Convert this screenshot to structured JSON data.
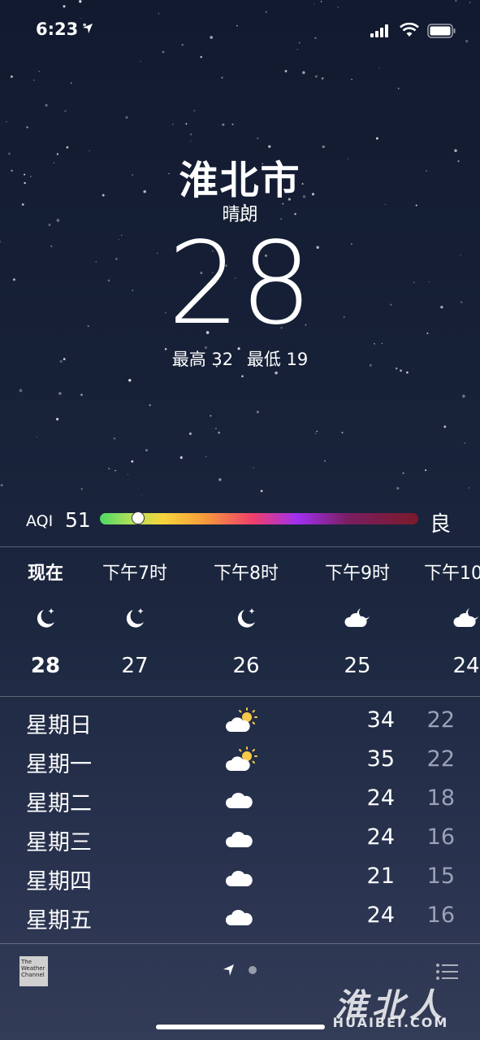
{
  "status_bar": {
    "time": "6:23"
  },
  "current": {
    "city": "淮北市",
    "condition": "晴朗",
    "temperature": "28",
    "high": "最高 32",
    "low": "最低 19"
  },
  "aqi": {
    "label": "AQI",
    "value": "51",
    "level": 0.12,
    "description": "良"
  },
  "hourly": [
    {
      "time": "现在",
      "icon": "moon-stars-icon",
      "temp": "28",
      "bold": true
    },
    {
      "time": "下午7时",
      "icon": "moon-stars-icon",
      "temp": "27"
    },
    {
      "time": "下午8时",
      "icon": "moon-stars-icon",
      "temp": "26"
    },
    {
      "time": "下午9时",
      "icon": "cloud-moon-icon",
      "temp": "25"
    },
    {
      "time": "下午10时",
      "icon": "cloud-moon-icon",
      "temp": "24"
    }
  ],
  "daily": [
    {
      "day": "星期日",
      "icon": "partly-cloudy-sun-icon",
      "high": "34",
      "low": "22"
    },
    {
      "day": "星期一",
      "icon": "partly-cloudy-sun-icon",
      "high": "35",
      "low": "22"
    },
    {
      "day": "星期二",
      "icon": "cloud-icon",
      "high": "24",
      "low": "18"
    },
    {
      "day": "星期三",
      "icon": "cloud-icon",
      "high": "24",
      "low": "16"
    },
    {
      "day": "星期四",
      "icon": "cloud-icon",
      "high": "21",
      "low": "15"
    },
    {
      "day": "星期五",
      "icon": "cloud-icon",
      "high": "24",
      "low": "16"
    }
  ],
  "footer": {
    "provider": "The Weather Channel"
  },
  "watermark": {
    "chinese": "淮北人",
    "domain": "HUAIBEI.COM"
  },
  "colors": {
    "aqi_good": "#4cd964",
    "sun": "#f7c948",
    "low_temp": "#9aa2b6"
  }
}
